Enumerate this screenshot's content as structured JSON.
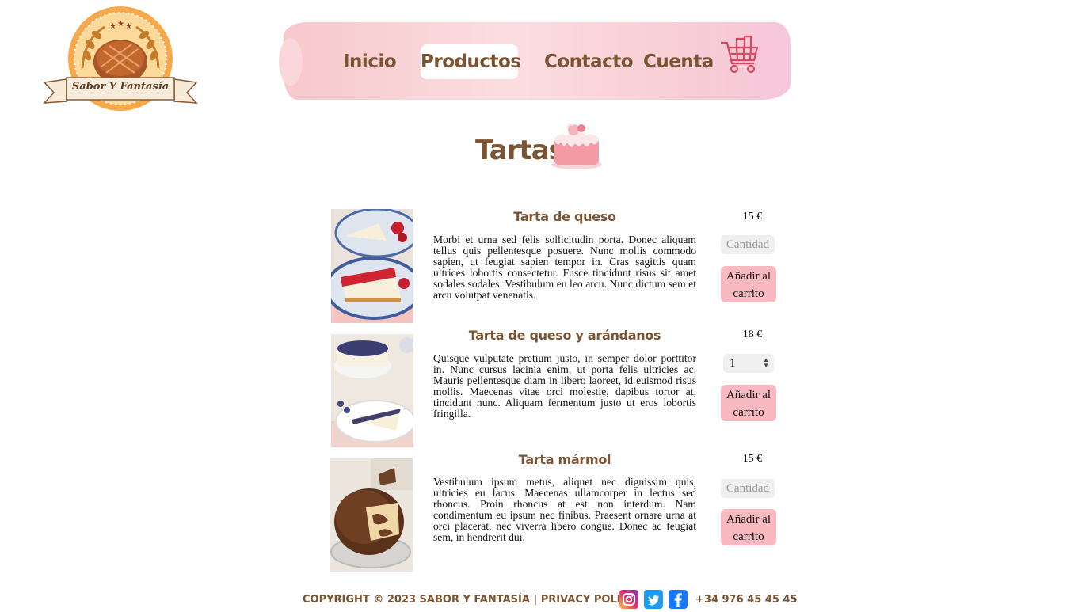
{
  "brand": {
    "logo_text": "Sabor Y Fantasía"
  },
  "nav": {
    "items": [
      {
        "label": "Inicio"
      },
      {
        "label": "Productos"
      },
      {
        "label": "Contacto"
      },
      {
        "label": "Cuenta"
      }
    ],
    "active": "Productos",
    "cart_icon": "shopping-cart-icon"
  },
  "section": {
    "title": "Tartas",
    "icon": "cake-icon"
  },
  "products": [
    {
      "name": "Tarta de queso",
      "description": "Morbi et urna sed felis sollicitudin porta. Donec aliquam tellus quis pellentesque posuere. Nunc mollis commodo sapien, ut feugiat sapien tempor in. Cras sagittis quam ultrices lobortis consectetur. Fusce tincidunt risus sit amet sodales sodales. Vestibulum eu leo arcu. Nunc dictum sem et arcu volutpat venenatis.",
      "price": "15 €",
      "quantity_placeholder": "Cantidad",
      "quantity_value": "",
      "add_label_line1": "Añadir al",
      "add_label_line2": "carrito"
    },
    {
      "name": "Tarta de queso y arándanos",
      "description": "Quisque vulputate pretium justo, in semper dolor porttitor in. Nunc cursus lacinia enim, ut porta felis ultricies ac. Mauris pellentesque diam in libero laoreet, id euismod risus mollis. Maecenas vitae orci molestie, dapibus tortor at, tincidunt nunc. Aliquam fermentum justo ut eros lobortis fringilla.",
      "price": "18 €",
      "quantity_placeholder": "Cantidad",
      "quantity_value": "1",
      "add_label_line1": "Añadir al",
      "add_label_line2": "carrito"
    },
    {
      "name": "Tarta mármol",
      "description": "Vestibulum ipsum metus, aliquet nec dignissim quis, ultricies eu lacus. Maecenas ullamcorper in lectus sed rhoncus. Proin rhoncus at est non interdum. Nam condimentum eu ipsum nec finibus. Praesent ornare urna at orci placerat, nec viverra libero congue. Donec ac feugiat sem, in hendrerit dui.",
      "price": "15 €",
      "quantity_placeholder": "Cantidad",
      "quantity_value": "",
      "add_label_line1": "Añadir al",
      "add_label_line2": "carrito"
    }
  ],
  "footer": {
    "copyright": "COPYRIGHT © 2023 SABOR Y FANTASÍA | PRIVACY POLICY",
    "social": [
      {
        "icon": "instagram-icon",
        "color": "#c2377e"
      },
      {
        "icon": "twitter-icon",
        "color": "#1d9bf0"
      },
      {
        "icon": "facebook-icon",
        "color": "#1877f2"
      }
    ],
    "phone": "+34 976 45 45 45"
  },
  "colors": {
    "brand_brown": "#7a5433",
    "nav_pink": "#f9d0d4",
    "button_pink": "#f8b9c0",
    "logo_orange": "#f5a94a"
  }
}
